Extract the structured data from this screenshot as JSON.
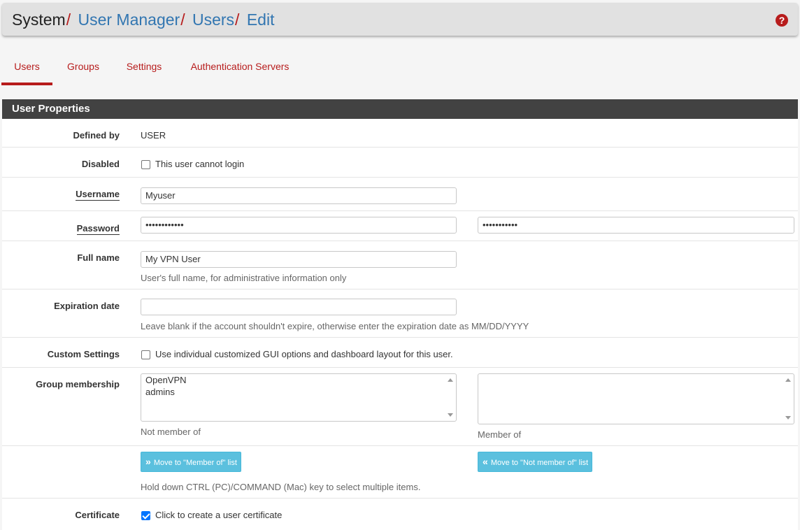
{
  "breadcrumb": {
    "root": "System",
    "items": [
      "User Manager",
      "Users",
      "Edit"
    ],
    "separator": "/"
  },
  "tabs": [
    "Users",
    "Groups",
    "Settings",
    "Authentication Servers"
  ],
  "panel": {
    "title": "User Properties"
  },
  "form": {
    "defined_by": {
      "label": "Defined by",
      "value": "USER"
    },
    "disabled": {
      "label": "Disabled",
      "checkbox_label": "This user cannot login",
      "checked": false
    },
    "username": {
      "label": "Username",
      "value": "Myuser"
    },
    "password": {
      "label": "Password",
      "value": "••••••••••••",
      "confirm_value": "•••••••••••"
    },
    "full_name": {
      "label": "Full name",
      "value": "My VPN User",
      "help": "User's full name, for administrative information only"
    },
    "expiration": {
      "label": "Expiration date",
      "value": "",
      "help": "Leave blank if the account shouldn't expire, otherwise enter the expiration date as MM/DD/YYYY"
    },
    "custom_settings": {
      "label": "Custom Settings",
      "checkbox_label": "Use individual customized GUI options and dashboard layout for this user.",
      "checked": false
    },
    "group_membership": {
      "label": "Group membership",
      "not_member_options": [
        "OpenVPN",
        "admins"
      ],
      "not_member_caption": "Not member of",
      "member_caption": "Member of"
    },
    "move_to_member": "Move to \"Member of\" list",
    "move_to_not_member": "Move to \"Not member of\" list",
    "multi_select_help": "Hold down CTRL (PC)/COMMAND (Mac) key to select multiple items.",
    "certificate": {
      "label": "Certificate",
      "checkbox_label": "Click to create a user certificate",
      "checked": true
    }
  },
  "icons": {
    "help": "question-circle-icon",
    "move_right": "double-chevron-right-icon",
    "move_left": "double-chevron-left-icon"
  },
  "colors": {
    "accent": "#b71c1c",
    "link": "#3276b1",
    "panel_header": "#424242",
    "info_button": "#5bc0de"
  }
}
